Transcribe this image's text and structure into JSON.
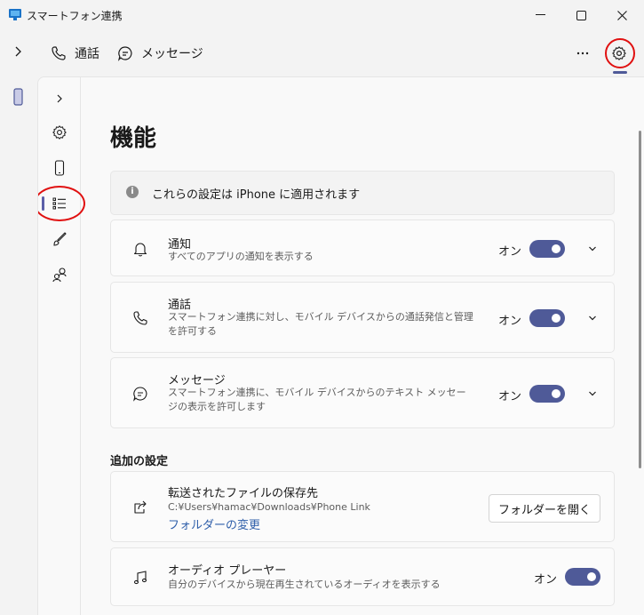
{
  "window": {
    "title": "スマートフォン連携",
    "minimize": "minimize-icon",
    "maximize": "maximize-icon",
    "close": "close-icon"
  },
  "toolbar": {
    "calls_label": "通話",
    "messages_label": "メッセージ",
    "more_icon": "more-icon",
    "settings_icon": "gear-icon"
  },
  "settings_nav": {
    "items": [
      "expand",
      "settings",
      "my-phone",
      "features",
      "personalization",
      "accounts"
    ],
    "selected": "features"
  },
  "page": {
    "title": "機能",
    "info": "これらの設定は iPhone に適用されます"
  },
  "features": [
    {
      "title": "通知",
      "desc": "すべてのアプリの通知を表示する",
      "state": "オン",
      "icon": "bell-icon"
    },
    {
      "title": "通話",
      "desc": "スマートフォン連携に対し、モバイル デバイスからの通話発信と管理を許可する",
      "state": "オン",
      "icon": "phone-icon"
    },
    {
      "title": "メッセージ",
      "desc": "スマートフォン連携に、モバイル デバイスからのテキスト メッセージの表示を許可します",
      "state": "オン",
      "icon": "message-icon"
    }
  ],
  "additional": {
    "section_label": "追加の設定",
    "transfer": {
      "title": "転送されたファイルの保存先",
      "path": "C:¥Users¥hamac¥Downloads¥Phone Link",
      "change_link": "フォルダーの変更",
      "open_button": "フォルダーを開く"
    },
    "audio": {
      "title": "オーディオ プレーヤー",
      "desc": "自分のデバイスから現在再生されているオーディオを表示する",
      "state": "オン"
    }
  },
  "colors": {
    "accent": "#4f5a98",
    "link": "#2f5faa",
    "annotation": "#e01010"
  }
}
